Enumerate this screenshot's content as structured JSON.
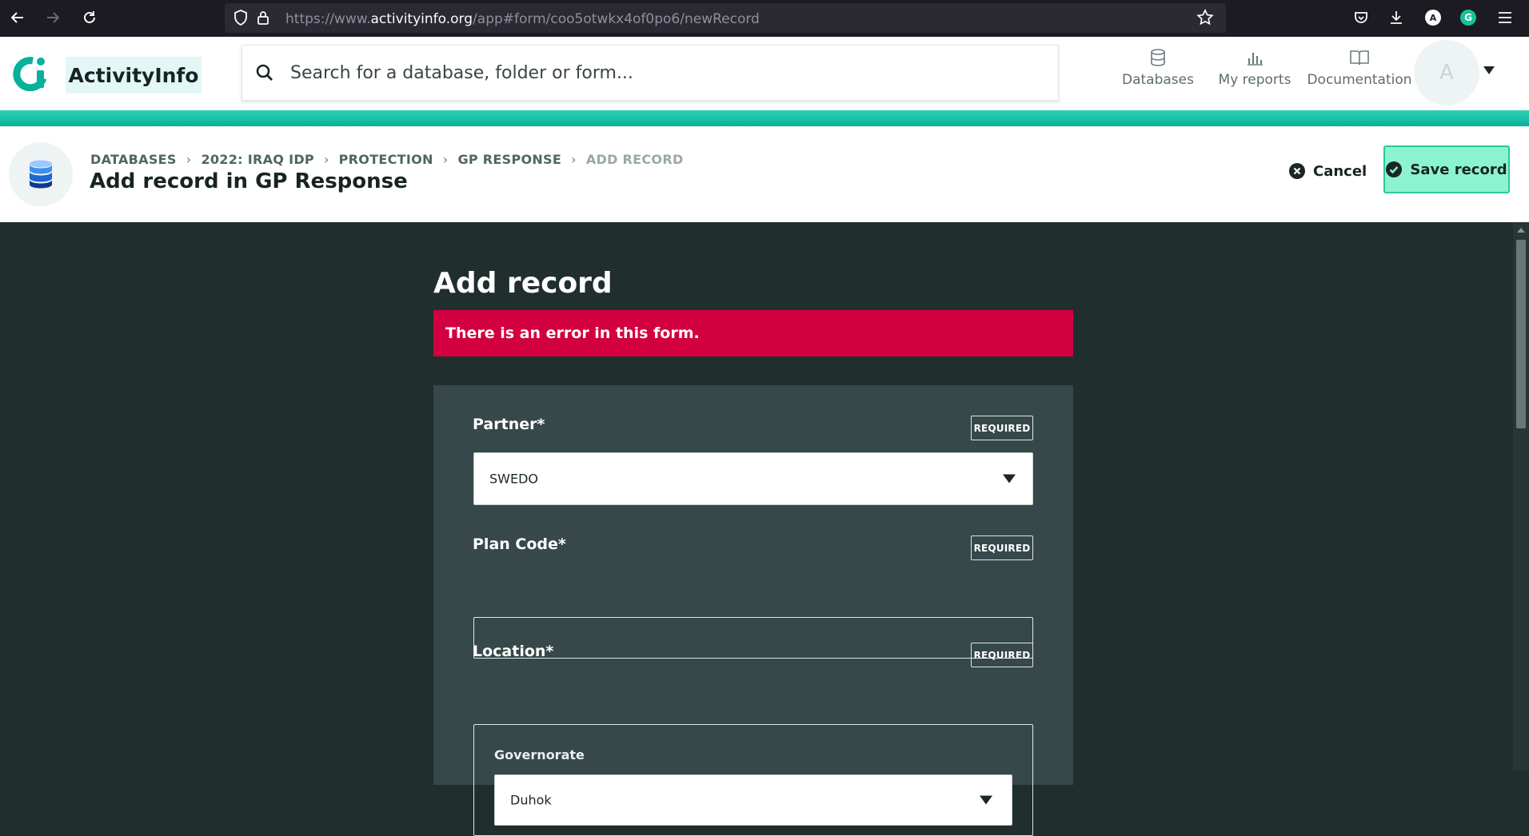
{
  "browser": {
    "url_prefix": "https://www.",
    "url_domain": "activityinfo.org",
    "url_path": "/app#form/coo5otwkx4of0po6/newRecord",
    "profile_letter": "A"
  },
  "header": {
    "brand": "ActivityInfo",
    "search_placeholder": "Search for a database, folder or form...",
    "nav": [
      {
        "label": "Databases",
        "icon": "database-icon"
      },
      {
        "label": "My reports",
        "icon": "bar-chart-icon"
      },
      {
        "label": "Documentation",
        "icon": "book-icon"
      }
    ],
    "avatar_letter": "A"
  },
  "page": {
    "breadcrumb": [
      "DATABASES",
      "2022: IRAQ IDP",
      "PROTECTION",
      "GP RESPONSE",
      "ADD RECORD"
    ],
    "title": "Add record in GP Response",
    "cancel_label": "Cancel",
    "save_label": "Save record"
  },
  "form": {
    "title": "Add record",
    "error_message": "There is an error in this form.",
    "required_badge": "REQUIRED",
    "fields": {
      "partner": {
        "label": "Partner*",
        "value": "SWEDO"
      },
      "plan_code": {
        "label": "Plan Code*",
        "value": ""
      },
      "location": {
        "label": "Location*",
        "governorate_label": "Governorate",
        "governorate_value": "Duhok"
      }
    }
  },
  "colors": {
    "accent": "#08b199",
    "error": "#d20040",
    "save_button": "#8cf3d0",
    "content_bg": "#212e2e",
    "card_bg": "#364849"
  }
}
